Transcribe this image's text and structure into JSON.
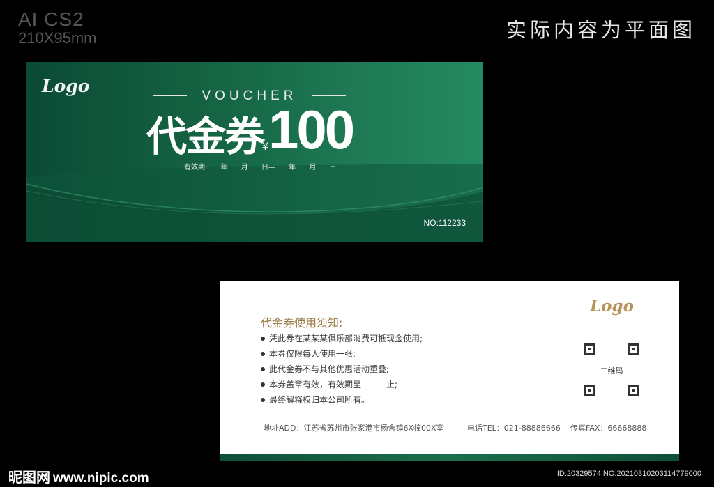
{
  "meta": {
    "software": "AI CS2",
    "size": "210X95mm"
  },
  "header": {
    "title": "实际内容为平面图"
  },
  "front": {
    "logo": "Logo",
    "voucher_word": "VOUCHER",
    "main_title": "代金券",
    "currency_symbol": "¥",
    "amount": "100",
    "validity": {
      "label": "有效期:",
      "year1": "年",
      "month1": "月",
      "day1": "日—",
      "year2": "年",
      "month2": "月",
      "day2": "日"
    },
    "number": "NO:112233",
    "colors": {
      "dark_green": "#0b4a35",
      "light_green": "#248a61"
    }
  },
  "back": {
    "logo": "Logo",
    "notice_title": "代金券使用须知:",
    "notices": [
      "凭此券在某某某俱乐部消费可抵现金使用;",
      "本券仅限每人使用一张;",
      "此代金券不与其他优惠活动重叠;",
      "本券盖章有效，有效期至　　　止;",
      "最终解释权归本公司所有。"
    ],
    "qr_label": "二维码",
    "address": "地址ADD：江苏省苏州市张家港市杨舍镇6X幢00X室",
    "tel": "电话TEL：021-88886666",
    "fax": "传真FAX：66668888",
    "colors": {
      "gold": "#b8945a"
    }
  },
  "watermark": {
    "site_cn": "昵图网",
    "site_url": "www.nipic.com",
    "id_line": "ID:20329574 NO:20210310203114779000"
  }
}
